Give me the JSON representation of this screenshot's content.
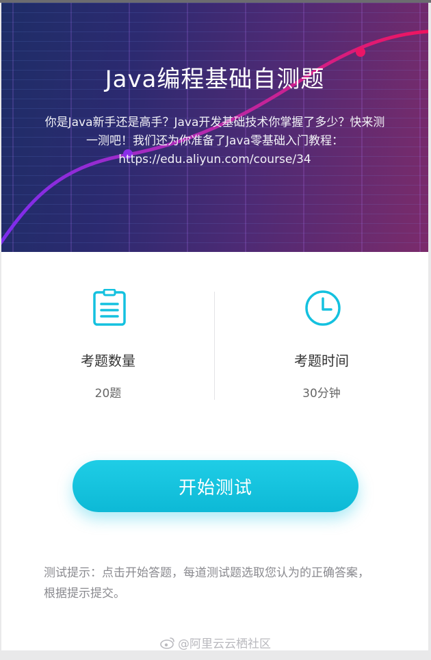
{
  "hero": {
    "title": "Java编程基础自测题",
    "description": "你是Java新手还是高手？Java开发基础技术你掌握了多少？快来测一测吧！我们还为你准备了Java零基础入门教程：https://edu.aliyun.com/course/34"
  },
  "stats": {
    "count": {
      "icon": "clipboard-icon",
      "label": "考题数量",
      "value": "20题"
    },
    "time": {
      "icon": "clock-icon",
      "label": "考题时间",
      "value": "30分钟"
    }
  },
  "actions": {
    "start_label": "开始测试"
  },
  "tip": "测试提示：点击开始答题，每道测试题选取您认为的正确答案，根据提示提交。",
  "watermark": "@阿里云云栖社区",
  "colors": {
    "accent": "#12c3dd",
    "hero_start": "#1e2d67",
    "hero_end": "#7b2b6b",
    "curve": "#e0186f"
  }
}
